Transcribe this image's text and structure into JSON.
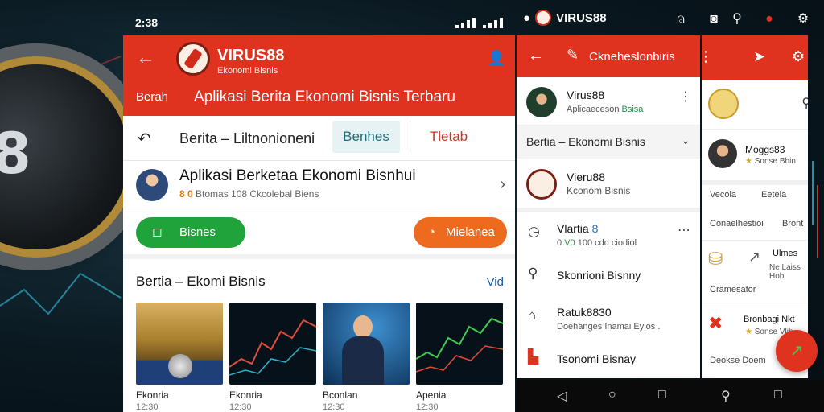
{
  "status": {
    "time": "2:38"
  },
  "brand": {
    "name": "VIRUS88",
    "tagline": "Ekonomi Bisnis"
  },
  "panel1": {
    "nav_label": "Berah",
    "page_title": "Aplikasi Berita Ekonomi Bisnis Terbaru",
    "tabs": {
      "main": "Berita – Liltnonioneni",
      "tab2": "Benhes",
      "tab3": "Tletab"
    },
    "card": {
      "title": "Aplikasi Berketaa Ekonomi Bisnhui",
      "sub_prefix": "8 0",
      "sub_rest": " Btomas 108 Ckcolebal Biens"
    },
    "buttons": {
      "green": "Bisnes",
      "orange": "Mielanea"
    },
    "section": {
      "title": "Bertia – Ekomi Bisnis",
      "link": "Vid"
    },
    "tiles": [
      {
        "caption": "Ekonria",
        "sub": "12:30"
      },
      {
        "caption": "Ekonria",
        "sub": "12:30"
      },
      {
        "caption": "Bconlan",
        "sub": "12:30"
      },
      {
        "caption": "Apenia",
        "sub": "12:30"
      }
    ]
  },
  "panel2": {
    "header_title": "Ckneheslonbiris",
    "profile": {
      "name": "Virus88",
      "sub_prefix": "Aplicaeceson",
      "sub_badge": "Bsisa"
    },
    "select": {
      "label": "Bertia – Ekonomi Bisnis"
    },
    "featured": {
      "name": "Vieru88",
      "sub": "Kconom Bisnis"
    },
    "list": [
      {
        "title": "Vlartia",
        "badge": "8",
        "sub_prefix": "0",
        "sub_badge": "V0",
        "sub_rest": " 100 cdd ciodiol"
      },
      {
        "title": "Skonrioni Bisnny"
      },
      {
        "title": "Ratuk8830",
        "sub": "Doehanges Inamai Eyios ."
      },
      {
        "title": "Tsonomi Bisnay"
      }
    ]
  },
  "panel3": {
    "box": {
      "name": "Moggs83",
      "sub_star": "★",
      "sub_rest": " Sonse Bbin"
    },
    "row1": {
      "left": "Vecoia",
      "right": "Eeteia"
    },
    "row2": {
      "left": "Conaelhestioi",
      "right": "Bront"
    },
    "item1": {
      "name": "Ulmes",
      "sub": "Ne Laiss Hob"
    },
    "row3": "Cramesafor",
    "item2": {
      "name": "Bronbagi Nkt",
      "sub_star": "★",
      "sub_rest": "Sonse Vlib"
    },
    "footer": "Deokse Doem"
  },
  "colors": {
    "brand_red": "#e0331f",
    "green": "#21a33b",
    "orange": "#ee6a1f",
    "link_blue": "#1a5bb5"
  },
  "icons": [
    "back-arrow-icon",
    "user-icon",
    "edit-icon",
    "send-icon",
    "settings-icon",
    "search-icon",
    "more-icon",
    "chevron-right-icon",
    "chevron-down-icon",
    "clock-icon",
    "bookmark-icon",
    "back-nav-icon",
    "home-nav-icon",
    "recents-nav-icon"
  ]
}
